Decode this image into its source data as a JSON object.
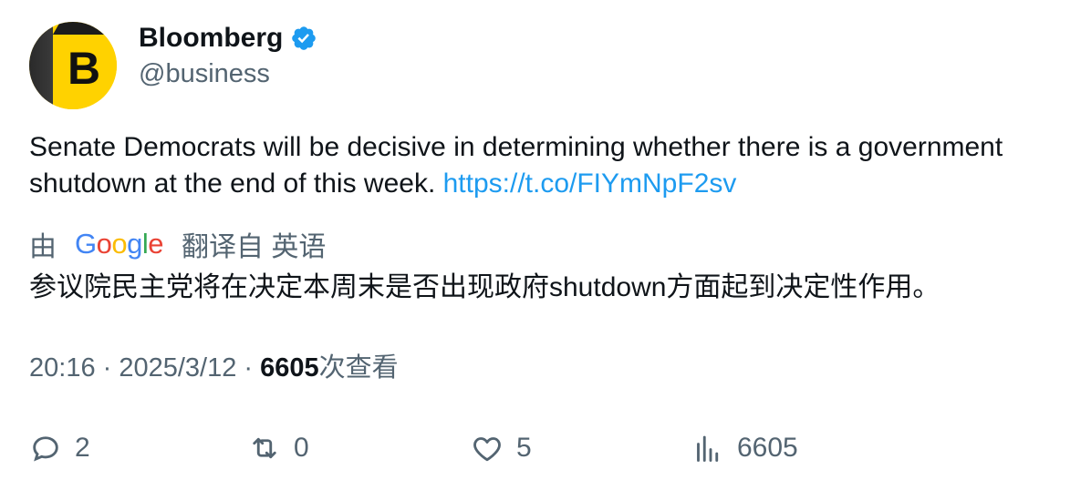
{
  "author": {
    "name": "Bloomberg",
    "handle": "@business",
    "avatar_letter": "B",
    "verified_icon": "verified-badge-icon"
  },
  "tweet": {
    "text": "Senate Democrats will be decisive in determining whether there is a government shutdown at the end of this week. ",
    "link": "https://t.co/FIYmNpF2sv"
  },
  "translation": {
    "by_label": "由",
    "google_letters": [
      "G",
      "o",
      "o",
      "g",
      "l",
      "e"
    ],
    "from_label": "翻译自 英语",
    "text": "参议院民主党将在决定本周末是否出现政府shutdown方面起到决定性作用。"
  },
  "meta": {
    "time": "20:16",
    "separator": " · ",
    "date": "2025/3/12",
    "views_count": "6605",
    "views_label": "次查看"
  },
  "actions": {
    "replies": "2",
    "retweets": "0",
    "likes": "5",
    "views": "6605"
  },
  "colors": {
    "accent": "#1d9bf0",
    "muted": "#536471",
    "text": "#0f1419",
    "avatar_yellow": "#ffd200"
  }
}
